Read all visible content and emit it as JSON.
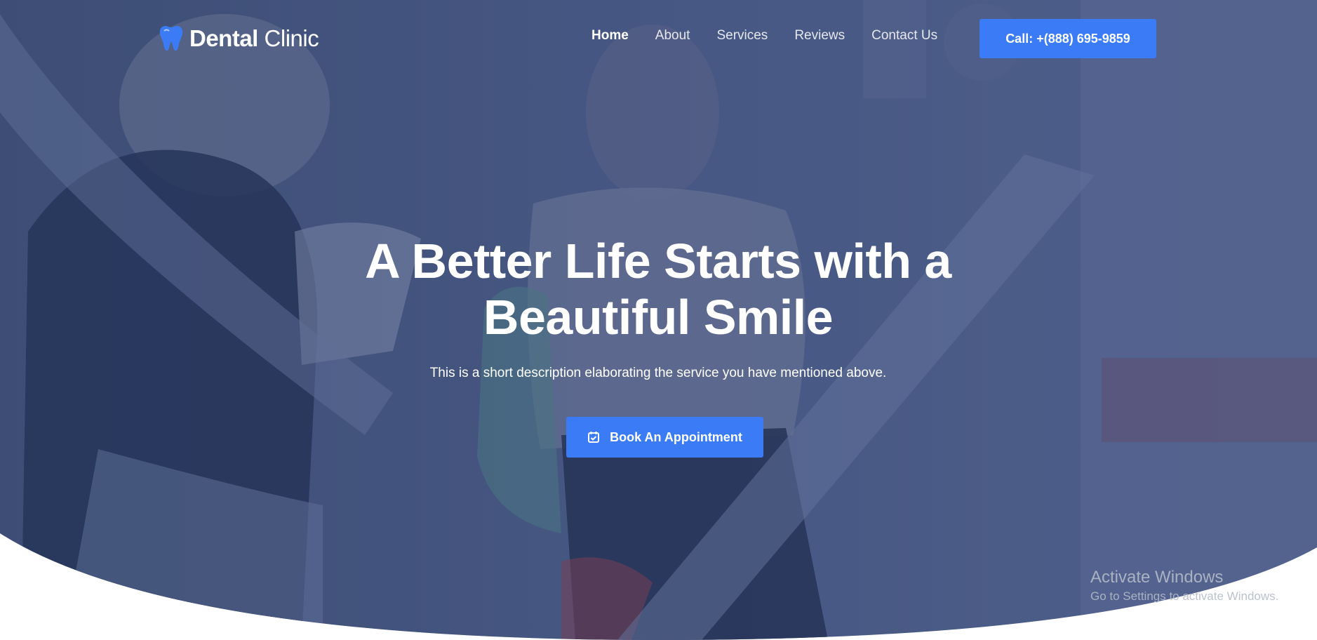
{
  "brand": {
    "name_bold": "Dental",
    "name_light": "Clinic",
    "logo_icon": "tooth-icon"
  },
  "nav": {
    "items": [
      {
        "label": "Home",
        "active": true
      },
      {
        "label": "About",
        "active": false
      },
      {
        "label": "Services",
        "active": false
      },
      {
        "label": "Reviews",
        "active": false
      },
      {
        "label": "Contact Us",
        "active": false
      }
    ],
    "call_label": "Call: +(888) 695-9859"
  },
  "hero": {
    "title_line1": "A Better Life Starts with a",
    "title_line2": "Beautiful Smile",
    "description": "This is a short description elaborating the service you have mentioned above.",
    "cta_label": "Book An Appointment",
    "cta_icon": "calendar-check-icon"
  },
  "watermark": {
    "title": "Activate Windows",
    "subtitle": "Go to Settings to activate Windows."
  },
  "colors": {
    "accent": "#3b7cf6",
    "overlay": "#3d4f7c",
    "text": "#ffffff"
  }
}
